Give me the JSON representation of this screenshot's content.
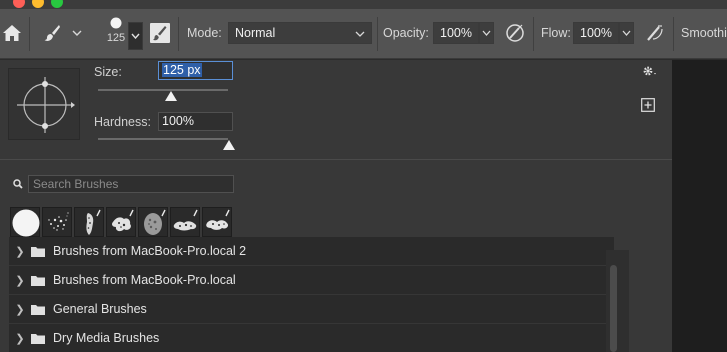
{
  "options_bar": {
    "brush_size": "125",
    "mode_label": "Mode:",
    "mode_value": "Normal",
    "opacity_label": "Opacity:",
    "opacity_value": "100%",
    "flow_label": "Flow:",
    "flow_value": "100%",
    "smoothing_label": "Smoothi"
  },
  "brush_panel": {
    "size_label": "Size:",
    "size_value": "125 px",
    "hardness_label": "Hardness:",
    "hardness_value": "100%",
    "search_placeholder": "Search Brushes",
    "brush_presets": [
      "hard-round",
      "spatter",
      "chalk",
      "splatter-1",
      "textured",
      "splatter-2",
      "splatter-3"
    ],
    "folders": [
      {
        "name": "Brushes from MacBook-Pro.local 2"
      },
      {
        "name": "Brushes from MacBook-Pro.local"
      },
      {
        "name": "General Brushes"
      },
      {
        "name": "Dry Media Brushes"
      }
    ]
  },
  "colors": {
    "options_bar_bg": "#535353",
    "panel_bg": "#383838",
    "list_bg": "#2a2a2a",
    "selection": "#2f5fa8"
  }
}
